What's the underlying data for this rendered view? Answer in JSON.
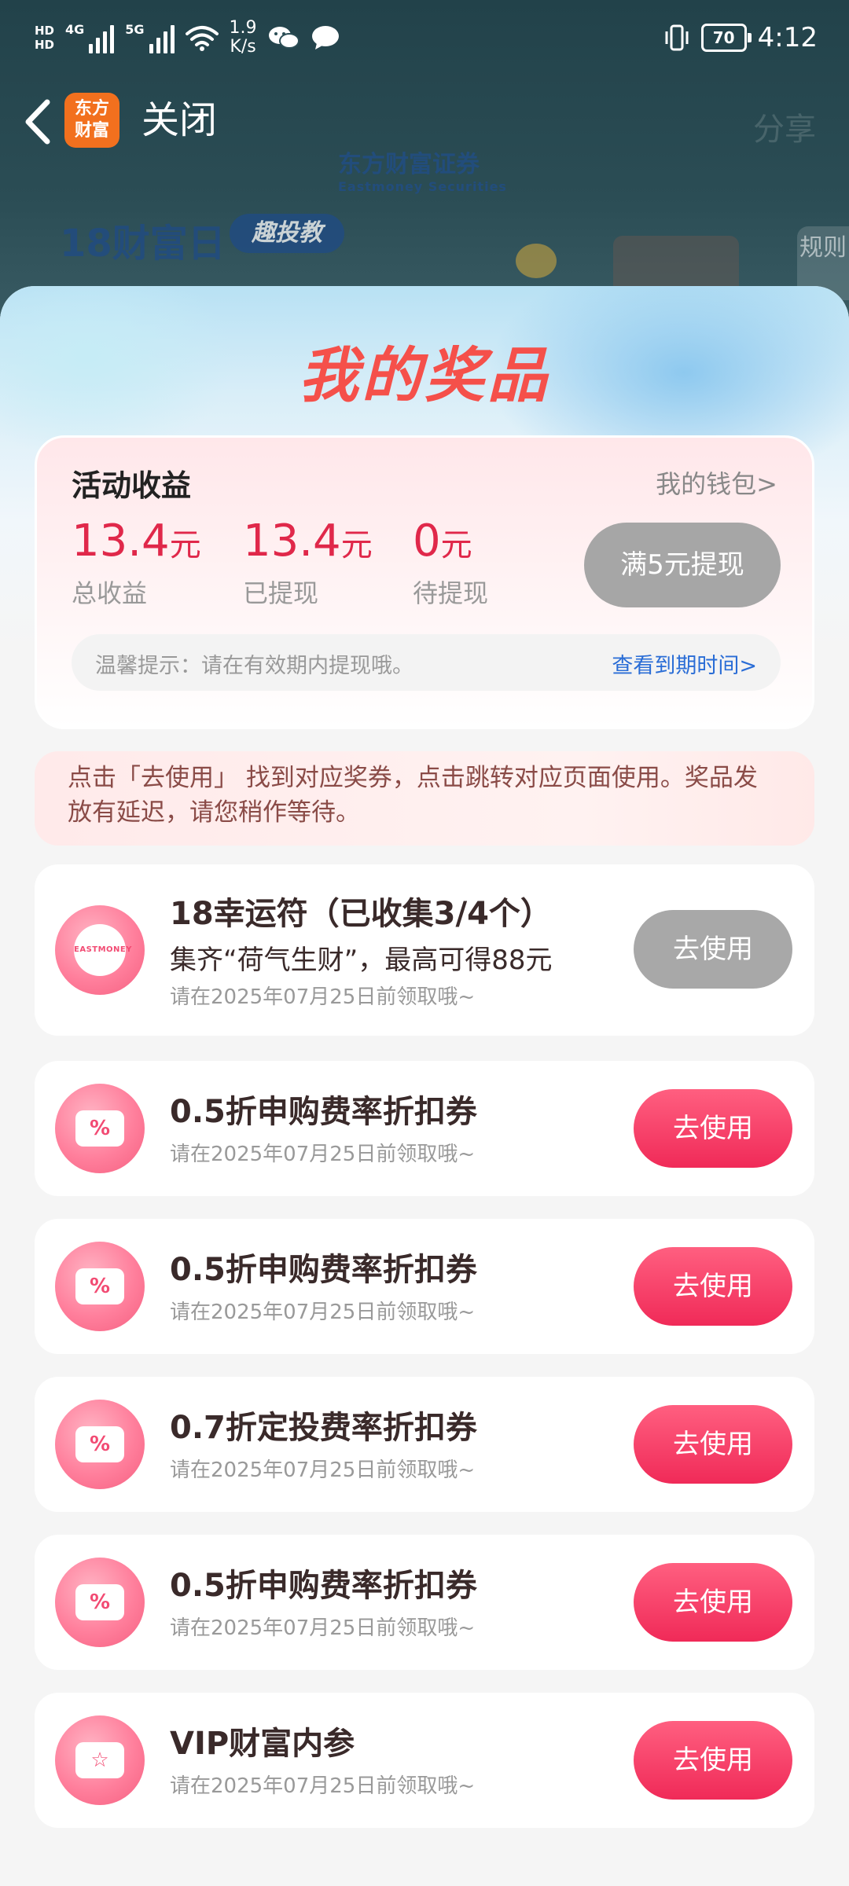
{
  "status_bar": {
    "hd_1": "HD",
    "hd_2": "HD",
    "net_1": "4G",
    "net_2": "5G",
    "speed_value": "1.9",
    "speed_unit": "K/s",
    "battery": "70",
    "time": "4:12"
  },
  "nav": {
    "logo_line1": "东方",
    "logo_line2": "财富",
    "close_label": "关闭",
    "share_label": "分享"
  },
  "banner": {
    "brand_cn": "东方财富证券",
    "brand_en": "Eastmoney Securities",
    "title": "18财富日",
    "tag": "趣投教",
    "rules": "规则"
  },
  "modal": {
    "title": "我的奖品"
  },
  "earnings": {
    "title": "活动收益",
    "wallet_link": "我的钱包>",
    "unit": "元",
    "stats": [
      {
        "value": "13.4",
        "label": "总收益"
      },
      {
        "value": "13.4",
        "label": "已提现"
      },
      {
        "value": "0",
        "label": "待提现"
      }
    ],
    "withdraw_button": "满5元提现",
    "tip": "温馨提示：请在有效期内提现哦。",
    "expiry_link": "查看到期时间>"
  },
  "notice": "点击「去使用」 找到对应奖券，点击跳转对应页面使用。奖品发放有延迟，请您稍作等待。",
  "prizes": [
    {
      "name": "18幸运符（已收集3/4个）",
      "desc": "集齐“荷气生财”，最高可得88元",
      "expiry": "请在2025年07月25日前领取哦~",
      "button": "去使用",
      "icon": "lucky-charm-badge-icon",
      "badge_text": "EASTMONEY",
      "enabled": false
    },
    {
      "name": "0.5折申购费率折扣券",
      "expiry": "请在2025年07月25日前领取哦~",
      "button": "去使用",
      "icon": "percent-coupon-icon",
      "enabled": true
    },
    {
      "name": "0.5折申购费率折扣券",
      "expiry": "请在2025年07月25日前领取哦~",
      "button": "去使用",
      "icon": "percent-coupon-icon",
      "enabled": true
    },
    {
      "name": "0.7折定投费率折扣券",
      "expiry": "请在2025年07月25日前领取哦~",
      "button": "去使用",
      "icon": "percent-coupon-icon",
      "enabled": true
    },
    {
      "name": "0.5折申购费率折扣券",
      "expiry": "请在2025年07月25日前领取哦~",
      "button": "去使用",
      "icon": "percent-coupon-icon",
      "enabled": true
    },
    {
      "name": "VIP财富内参",
      "expiry": "请在2025年07月25日前领取哦~",
      "button": "去使用",
      "icon": "star-ticket-icon",
      "enabled": true
    }
  ],
  "colors": {
    "accent_red": "#e0284a",
    "use_button": "#f02a58",
    "disabled_button": "#a8a8a8",
    "title_red": "#f5504a",
    "link_blue": "#2a6dd6"
  }
}
